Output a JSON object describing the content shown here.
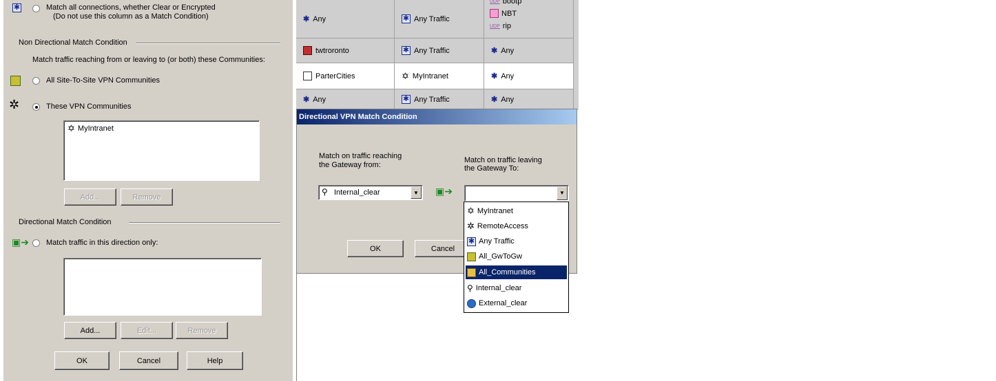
{
  "left_dialog": {
    "match_all_line1": "Match all connections, whether Clear or Encrypted",
    "match_all_line2": "(Do not use this column as a Match Condition)",
    "non_directional_header": "Non Directional Match Condition",
    "non_directional_desc": "Match traffic reaching from or leaving to (or both) these Communities:",
    "all_s2s_label": "All Site-To-Site VPN Communities",
    "these_vpn_label": "These VPN Communities",
    "communities_list": [
      "MyIntranet"
    ],
    "add_label": "Add...",
    "remove_label": "Remove",
    "directional_header": "Directional Match Condition",
    "direction_only_label": "Match traffic in this direction only:",
    "add2_label": "Add...",
    "edit_label": "Edit...",
    "remove2_label": "Remove",
    "ok_label": "OK",
    "cancel_label": "Cancel",
    "help_label": "Help"
  },
  "rule_table": {
    "rows": [
      {
        "c1": "Any",
        "c2": "Any Traffic",
        "c3": [
          "bootp",
          "NBT",
          "rip"
        ]
      },
      {
        "c1": "twtroronto",
        "c2": "Any Traffic",
        "c3": [
          "Any"
        ]
      },
      {
        "c1": "ParterCities",
        "c2": "MyIntranet",
        "c3": [
          "Any"
        ]
      },
      {
        "c1": "Any",
        "c2": "Any Traffic",
        "c3": [
          "Any"
        ]
      }
    ],
    "udp_tag": "UDP"
  },
  "vpn_dialog": {
    "title": "Directional VPN Match Condition",
    "from_label_line1": "Match on traffic reaching",
    "from_label_line2": "the Gateway from:",
    "to_label_line1": "Match on traffic leaving",
    "to_label_line2": "the Gateway To:",
    "from_value": "Internal_clear",
    "to_value": "",
    "ok_label": "OK",
    "cancel_label": "Cancel",
    "dropdown_options": [
      "MyIntranet",
      "RemoteAccess",
      "Any Traffic",
      "All_GwToGw",
      "All_Communities",
      "Internal_clear",
      "External_clear"
    ],
    "dropdown_selected": "All_Communities"
  }
}
